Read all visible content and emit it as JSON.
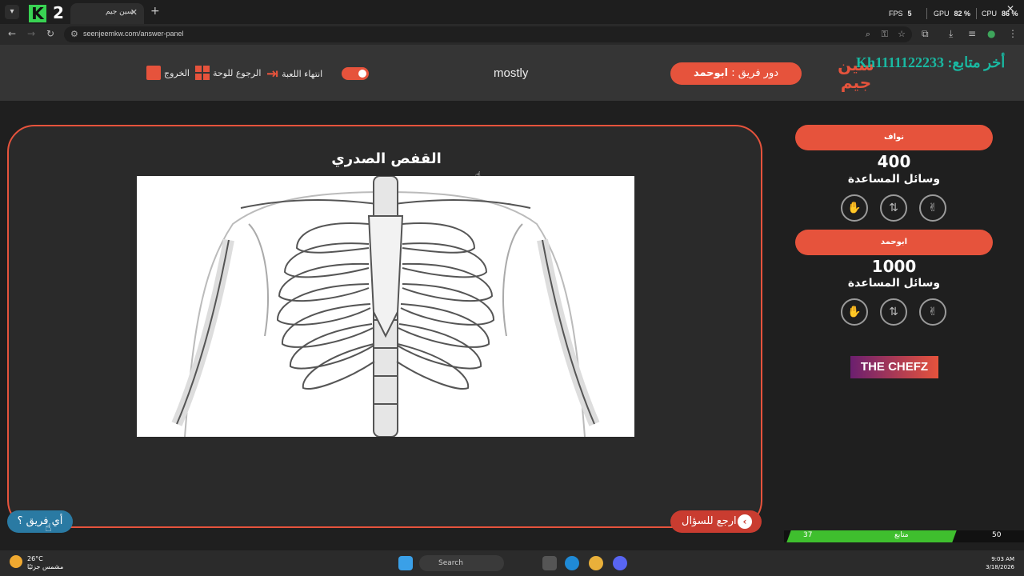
{
  "browser": {
    "tab_title": "سين جيم",
    "url": "seenjeemkw.com/answer-panel",
    "overlay_number": "2",
    "perf": {
      "fps_label": "FPS",
      "fps": "5",
      "gpu_label": "GPU",
      "gpu": "82 %",
      "cpu_label": "CPU",
      "cpu": "86 %"
    }
  },
  "header": {
    "exit_label": "الخروج",
    "back_to_board_label": "الرجوع للوحة",
    "end_game_label": "انتهاء اللعبة",
    "answer_word": "mostly",
    "turn_prefix": "دور فريق :",
    "turn_team": "ابوحمد",
    "logo_text": "سين جيم",
    "overlay_text": "Kh1111122233 :أخر متابع"
  },
  "question": {
    "title": "القفص الصدري",
    "back_button_label": "ارجع للسؤال",
    "which_team_label": "أي فريق ؟"
  },
  "teams": [
    {
      "name": "نواف",
      "score": "400",
      "aids_label": "وسائل المساعدة"
    },
    {
      "name": "ابوحمد",
      "score": "1000",
      "aids_label": "وسائل المساعدة"
    }
  ],
  "aid_icons": [
    "hand-stop-icon",
    "swap-icon",
    "two-answers-icon"
  ],
  "sponsor": "THE CHEFZ",
  "stream_bar": {
    "left_value": "37",
    "label": "متابع",
    "right_value": "50",
    "progress": 0.74
  },
  "taskbar": {
    "temperature": "26°C",
    "weather_desc": "مشمس جزئيًا",
    "search_label": "Search",
    "time": "9:03 AM",
    "date": "3/18/2026"
  },
  "colors": {
    "accent": "#e6533c",
    "bg": "#2a2a2a",
    "header": "#353535",
    "which_team": "#2a7aa3"
  }
}
